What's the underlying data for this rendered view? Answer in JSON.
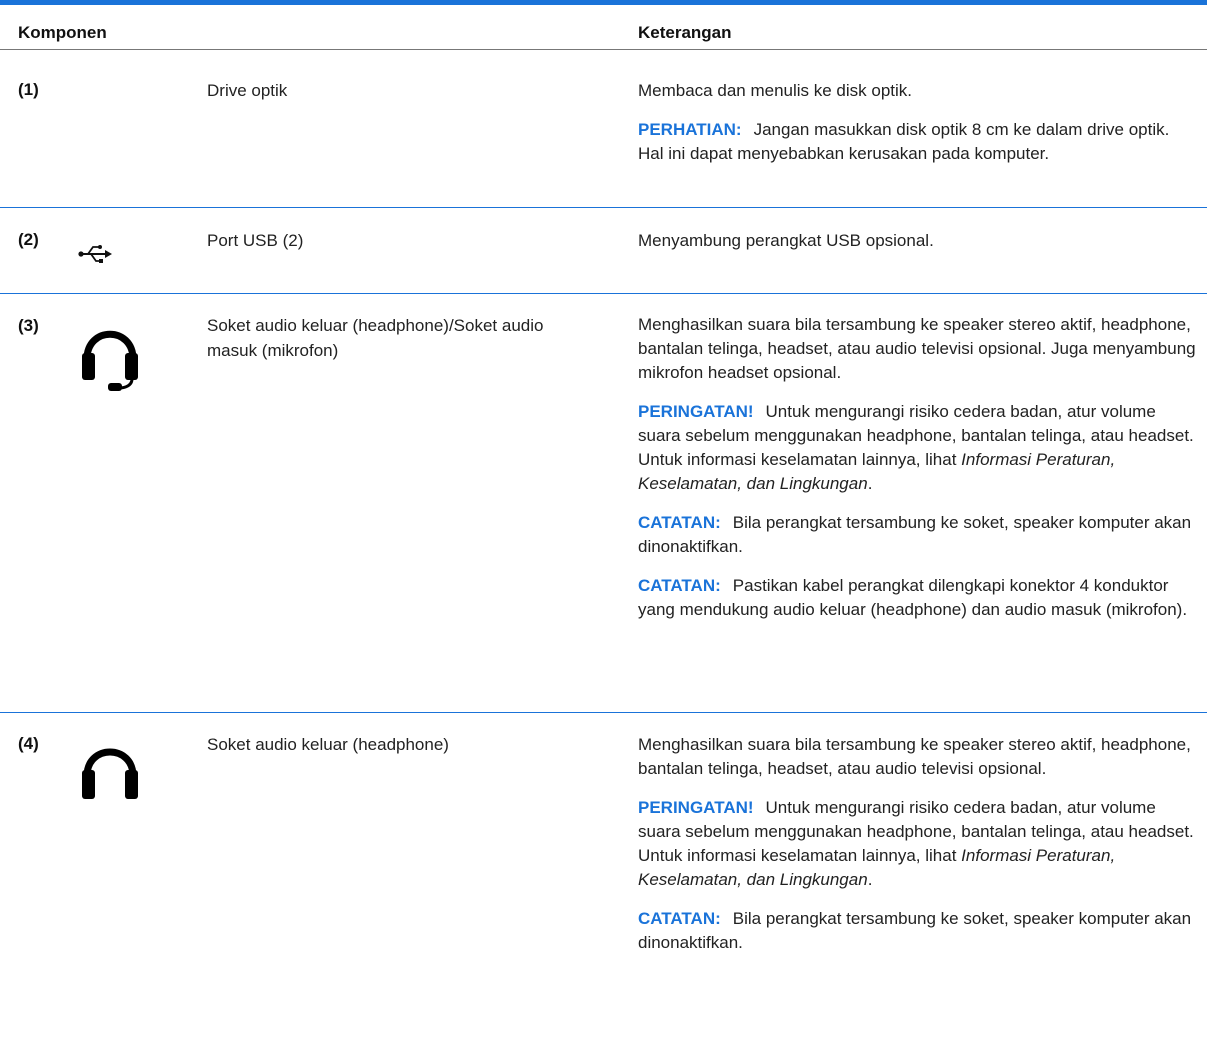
{
  "table": {
    "header": {
      "component": "Komponen",
      "description": "Keterangan"
    },
    "rows": [
      {
        "number": "(1)",
        "icon": "none",
        "component": "Drive optik",
        "desc": "Membaca dan menulis ke disk optik.",
        "note": {
          "label": "PERHATIAN:",
          "text": "Jangan masukkan disk optik 8 cm ke dalam drive optik. Hal ini dapat menyebabkan kerusakan pada komputer."
        }
      },
      {
        "number": "(2)",
        "icon": "usb-icon",
        "component": "Port USB (2)",
        "desc": "Menyambung perangkat USB opsional."
      },
      {
        "number": "(3)",
        "icon": "headset-icon",
        "component": "Soket audio keluar (headphone)/Soket audio masuk (mikrofon)",
        "desc": "Menghasilkan suara bila tersambung ke speaker stereo aktif, headphone, bantalan telinga, headset, atau audio televisi opsional. Juga menyambung mikrofon headset opsional.",
        "warning": {
          "label": "PERINGATAN!",
          "text": "Untuk mengurangi risiko cedera badan, atur volume suara sebelum menggunakan headphone, bantalan telinga, atau headset. Untuk informasi keselamatan lainnya, lihat",
          "ref": "Informasi Peraturan, Keselamatan, dan Lingkungan",
          "end": "."
        },
        "note1": {
          "label": "CATATAN:",
          "text": "Bila perangkat tersambung ke soket, speaker komputer akan dinonaktifkan."
        },
        "note2": {
          "label": "CATATAN:",
          "text": "Pastikan kabel perangkat dilengkapi konektor 4 konduktor yang mendukung audio keluar (headphone) dan audio masuk (mikrofon)."
        }
      },
      {
        "number": "(4)",
        "icon": "headphone-icon",
        "component": "Soket audio keluar (headphone)",
        "desc": "Menghasilkan suara bila tersambung ke speaker stereo aktif, headphone, bantalan telinga, headset, atau audio televisi opsional.",
        "warning": {
          "label": "PERINGATAN!",
          "text": "Untuk mengurangi risiko cedera badan, atur volume suara sebelum menggunakan headphone, bantalan telinga, atau headset. Untuk informasi keselamatan lainnya, lihat",
          "ref": "Informasi Peraturan, Keselamatan, dan Lingkungan",
          "end": "."
        },
        "note1": {
          "label": "CATATAN:",
          "text": "Bila perangkat tersambung ke soket, speaker komputer akan dinonaktifkan."
        }
      }
    ]
  },
  "colors": {
    "accent": "#1a73d9",
    "text": "#222222",
    "header_rule": "#777777"
  }
}
